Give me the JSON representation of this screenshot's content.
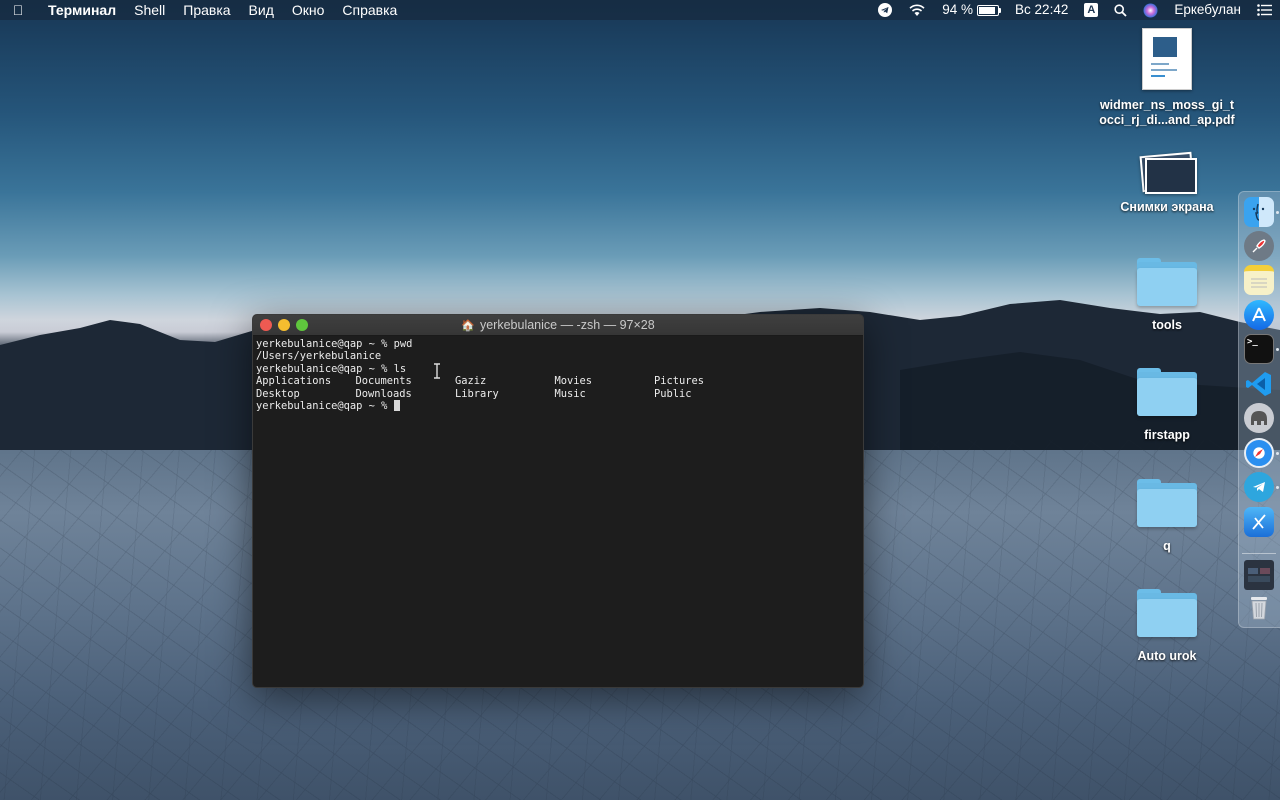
{
  "menubar": {
    "apple_icon": "apple-icon",
    "app_name": "Терминал",
    "menus": [
      "Shell",
      "Правка",
      "Вид",
      "Окно",
      "Справка"
    ],
    "battery_percent": "94 %",
    "battery_level": 0.94,
    "datetime": "Вс 22:42",
    "input_source": "A",
    "user": "Еркебулан"
  },
  "terminal": {
    "title": "yerkebulanice — -zsh — 97×28",
    "lines": [
      "yerkebulanice@qap ~ % pwd",
      "/Users/yerkebulanice",
      "yerkebulanice@qap ~ % ls"
    ],
    "ls_rows": [
      [
        "Applications",
        "Documents",
        "Gaziz",
        "Movies",
        "Pictures"
      ],
      [
        "Desktop",
        "Downloads",
        "Library",
        "Music",
        "Public"
      ]
    ],
    "prompt": "yerkebulanice@qap ~ % "
  },
  "desktop": {
    "pdf_label_line1": "widmer_ns_moss_gi_t",
    "pdf_label_line2": "occi_rj_di...and_ap.pdf",
    "screenshots_label": "Снимки экрана",
    "folders": [
      "tools",
      "firstapp",
      "q",
      "Auto urok"
    ]
  },
  "dock": {
    "items": [
      "finder-icon",
      "launchpad-icon",
      "notes-icon",
      "app-store-icon",
      "terminal-icon",
      "vscode-icon",
      "sequel-pro-icon",
      "safari-icon",
      "telegram-icon",
      "xcode-icon",
      "downloads-stack-icon",
      "trash-icon"
    ]
  },
  "colors": {
    "terminal_bg": "#1d1d1d",
    "terminal_text": "#ececec",
    "folder_blue": "#8fd0f2"
  }
}
